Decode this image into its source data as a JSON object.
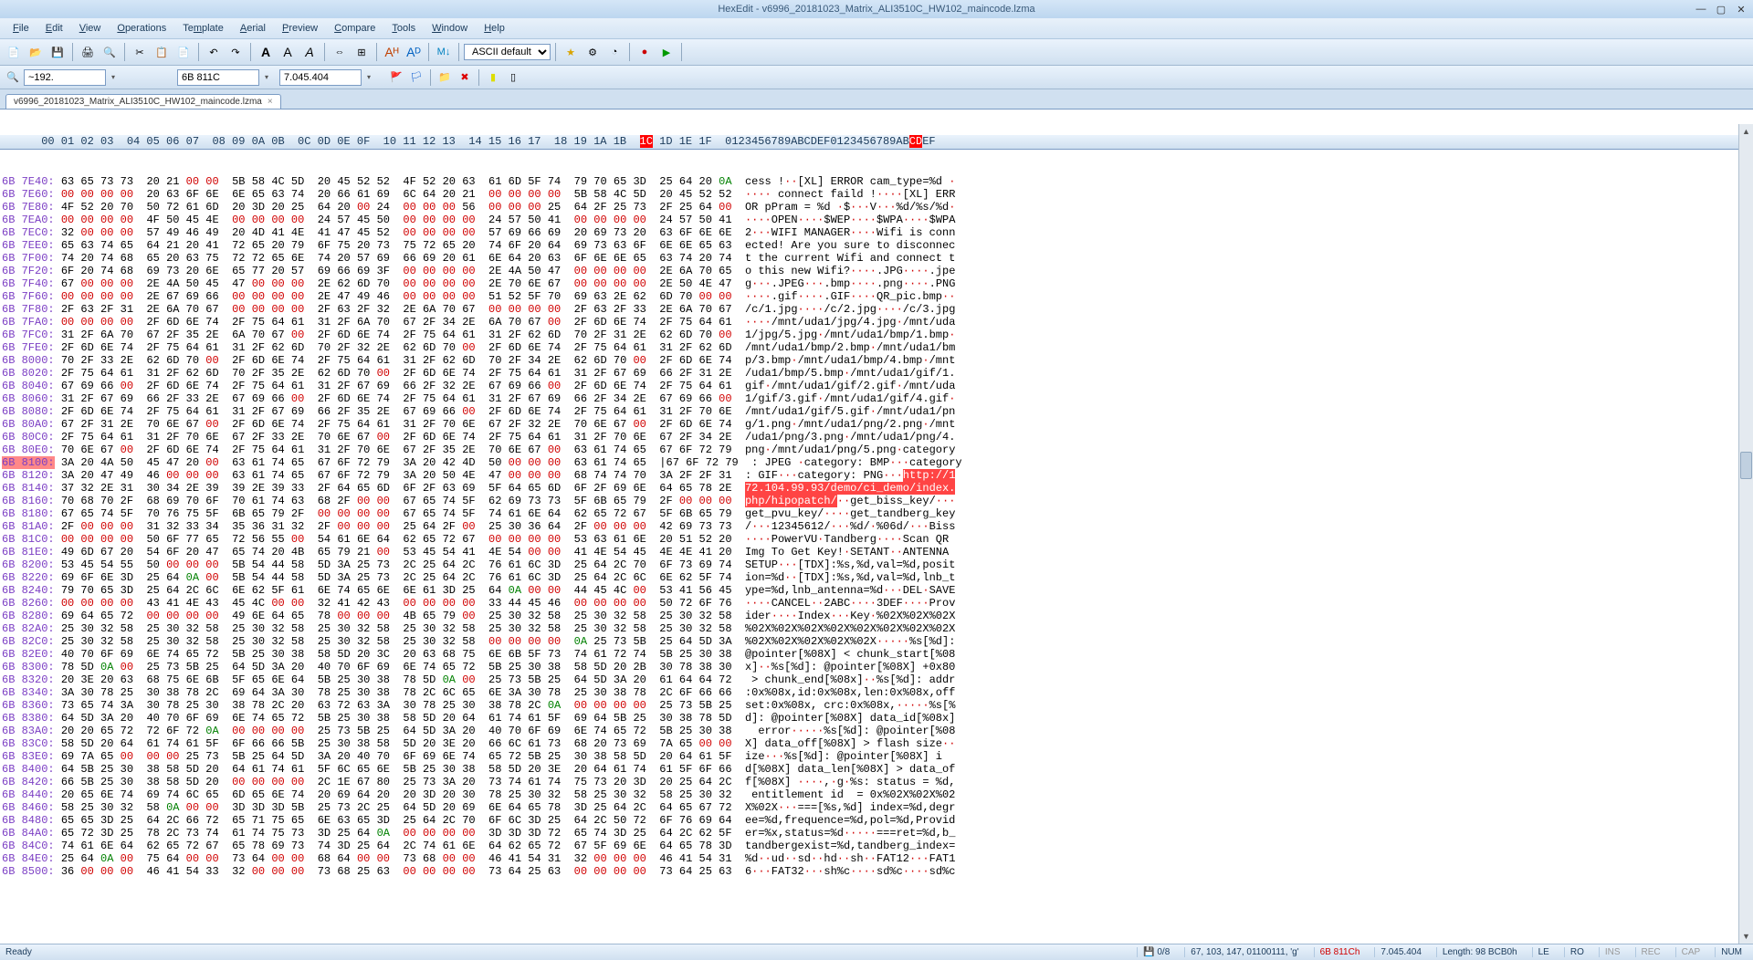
{
  "title": "HexEdit - v6996_20181023_Matrix_ALI3510C_HW102_maincode.lzma",
  "menu": [
    "File",
    "Edit",
    "View",
    "Operations",
    "Template",
    "Aerial",
    "Preview",
    "Compare",
    "Tools",
    "Window",
    "Help"
  ],
  "toolbar": {
    "encoding_select": "ASCII default"
  },
  "toolbar2": {
    "search_hist": "~192.",
    "hex_addr": "6B 811C",
    "dec_addr": "7.045.404"
  },
  "tab": {
    "label": "v6996_20181023_Matrix_ALI3510C_HW102_maincode.lzma"
  },
  "header": {
    "offset_cols": "      00 01 02 03  04 05 06 07  08 09 0A 0B  0C 0D 0E 0F  10 11 12 13  14 15 16 17  18 19 1A 1B  ",
    "hl": "1C",
    "rest": " 1D 1E 1F  0123456789ABCDEF0123456789AB",
    "hl2": "CD",
    "rest2": "EF"
  },
  "rows": [
    {
      "a": "6B 7E40:",
      "h": "63 65 73 73  20 21 00 00  5B 58 4C 5D  20 45 52 52  4F 52 20 63  61 6D 5F 74  79 70 65 3D  25 64 20 0A",
      "t": "cess !··[XL] ERROR cam_type=%d ·"
    },
    {
      "a": "6B 7E60:",
      "h": "00 00 00 00  20 63 6F 6E  6E 65 63 74  20 66 61 69  6C 64 20 21  00 00 00 00  5B 58 4C 5D  20 45 52 52",
      "t": "···· connect faild !····[XL] ERR"
    },
    {
      "a": "6B 7E80:",
      "h": "4F 52 20 70  50 72 61 6D  20 3D 20 25  64 20 00 24  00 00 00 56  00 00 00 25  64 2F 25 73  2F 25 64 00",
      "t": "OR pPram = %d ·$···V···%d/%s/%d·"
    },
    {
      "a": "6B 7EA0:",
      "h": "00 00 00 00  4F 50 45 4E  00 00 00 00  24 57 45 50  00 00 00 00  24 57 50 41  00 00 00 00  24 57 50 41",
      "t": "····OPEN····$WEP····$WPA····$WPA"
    },
    {
      "a": "6B 7EC0:",
      "h": "32 00 00 00  57 49 46 49  20 4D 41 4E  41 47 45 52  00 00 00 00  57 69 66 69  20 69 73 20  63 6F 6E 6E",
      "t": "2···WIFI MANAGER····Wifi is conn"
    },
    {
      "a": "6B 7EE0:",
      "h": "65 63 74 65  64 21 20 41  72 65 20 79  6F 75 20 73  75 72 65 20  74 6F 20 64  69 73 63 6F  6E 6E 65 63",
      "t": "ected! Are you sure to disconnec"
    },
    {
      "a": "6B 7F00:",
      "h": "74 20 74 68  65 20 63 75  72 72 65 6E  74 20 57 69  66 69 20 61  6E 64 20 63  6F 6E 6E 65  63 74 20 74",
      "t": "t the current Wifi and connect t"
    },
    {
      "a": "6B 7F20:",
      "h": "6F 20 74 68  69 73 20 6E  65 77 20 57  69 66 69 3F  00 00 00 00  2E 4A 50 47  00 00 00 00  2E 6A 70 65",
      "t": "o this new Wifi?····.JPG····.jpe"
    },
    {
      "a": "6B 7F40:",
      "h": "67 00 00 00  2E 4A 50 45  47 00 00 00  2E 62 6D 70  00 00 00 00  2E 70 6E 67  00 00 00 00  2E 50 4E 47",
      "t": "g···.JPEG···.bmp····.png····.PNG"
    },
    {
      "a": "6B 7F60:",
      "h": "00 00 00 00  2E 67 69 66  00 00 00 00  2E 47 49 46  00 00 00 00  51 52 5F 70  69 63 2E 62  6D 70 00 00",
      "t": "····.gif····.GIF····QR_pic.bmp··"
    },
    {
      "a": "6B 7F80:",
      "h": "2F 63 2F 31  2E 6A 70 67  00 00 00 00  2F 63 2F 32  2E 6A 70 67  00 00 00 00  2F 63 2F 33  2E 6A 70 67",
      "t": "/c/1.jpg····/c/2.jpg····/c/3.jpg"
    },
    {
      "a": "6B 7FA0:",
      "h": "00 00 00 00  2F 6D 6E 74  2F 75 64 61  31 2F 6A 70  67 2F 34 2E  6A 70 67 00  2F 6D 6E 74  2F 75 64 61",
      "t": "····/mnt/uda1/jpg/4.jpg·/mnt/uda"
    },
    {
      "a": "6B 7FC0:",
      "h": "31 2F 6A 70  67 2F 35 2E  6A 70 67 00  2F 6D 6E 74  2F 75 64 61  31 2F 62 6D  70 2F 31 2E  62 6D 70 00",
      "t": "1/jpg/5.jpg·/mnt/uda1/bmp/1.bmp·"
    },
    {
      "a": "6B 7FE0:",
      "h": "2F 6D 6E 74  2F 75 64 61  31 2F 62 6D  70 2F 32 2E  62 6D 70 00  2F 6D 6E 74  2F 75 64 61  31 2F 62 6D",
      "t": "/mnt/uda1/bmp/2.bmp·/mnt/uda1/bm"
    },
    {
      "a": "6B 8000:",
      "h": "70 2F 33 2E  62 6D 70 00  2F 6D 6E 74  2F 75 64 61  31 2F 62 6D  70 2F 34 2E  62 6D 70 00  2F 6D 6E 74",
      "t": "p/3.bmp·/mnt/uda1/bmp/4.bmp·/mnt"
    },
    {
      "a": "6B 8020:",
      "h": "2F 75 64 61  31 2F 62 6D  70 2F 35 2E  62 6D 70 00  2F 6D 6E 74  2F 75 64 61  31 2F 67 69  66 2F 31 2E",
      "t": "/uda1/bmp/5.bmp·/mnt/uda1/gif/1."
    },
    {
      "a": "6B 8040:",
      "h": "67 69 66 00  2F 6D 6E 74  2F 75 64 61  31 2F 67 69  66 2F 32 2E  67 69 66 00  2F 6D 6E 74  2F 75 64 61",
      "t": "gif·/mnt/uda1/gif/2.gif·/mnt/uda"
    },
    {
      "a": "6B 8060:",
      "h": "31 2F 67 69  66 2F 33 2E  67 69 66 00  2F 6D 6E 74  2F 75 64 61  31 2F 67 69  66 2F 34 2E  67 69 66 00",
      "t": "1/gif/3.gif·/mnt/uda1/gif/4.gif·"
    },
    {
      "a": "6B 8080:",
      "h": "2F 6D 6E 74  2F 75 64 61  31 2F 67 69  66 2F 35 2E  67 69 66 00  2F 6D 6E 74  2F 75 64 61  31 2F 70 6E",
      "t": "/mnt/uda1/gif/5.gif·/mnt/uda1/pn"
    },
    {
      "a": "6B 80A0:",
      "h": "67 2F 31 2E  70 6E 67 00  2F 6D 6E 74  2F 75 64 61  31 2F 70 6E  67 2F 32 2E  70 6E 67 00  2F 6D 6E 74",
      "t": "g/1.png·/mnt/uda1/png/2.png·/mnt"
    },
    {
      "a": "6B 80C0:",
      "h": "2F 75 64 61  31 2F 70 6E  67 2F 33 2E  70 6E 67 00  2F 6D 6E 74  2F 75 64 61  31 2F 70 6E  67 2F 34 2E",
      "t": "/uda1/png/3.png·/mnt/uda1/png/4."
    },
    {
      "a": "6B 80E0:",
      "h": "70 6E 67 00  2F 6D 6E 74  2F 75 64 61  31 2F 70 6E  67 2F 35 2E  70 6E 67 00  63 61 74 65  67 6F 72 79",
      "t": "png·/mnt/uda1/png/5.png·category"
    },
    {
      "a": "6B 8100:",
      "h": "3A 20 4A 50  45 47 20 00  63 61 74 65  67 6F 72 79  3A 20 42 4D  50 00 00 00  63 61 74 65  |67 6F 72 79",
      "t": ": JPEG ·category: BMP···category",
      "cursor": true
    },
    {
      "a": "6B 8120:",
      "h": "3A 20 47 49  46 00 00 00  63 61 74 65  67 6F 72 79  3A 20 50 4E  47 00 00 00  68 74 74 70  3A 2F 2F 31",
      "t": ": GIF···category: PNG···",
      "hl": "http://1"
    },
    {
      "a": "6B 8140:",
      "h": "37 32 2E 31  30 34 2E 39  39 2E 39 33  2F 64 65 6D  6F 2F 63 69  5F 64 65 6D  6F 2F 69 6E  64 65 78 2E",
      "t": "",
      "hl": "72.104.99.93/demo/ci_demo/index."
    },
    {
      "a": "6B 8160:",
      "h": "70 68 70 2F  68 69 70 6F  70 61 74 63  68 2F 00 00  67 65 74 5F  62 69 73 73  5F 6B 65 79  2F 00 00 00",
      "t": "",
      "hl": "php/hipopatch/",
      "t2": "··get_biss_key/···"
    },
    {
      "a": "6B 8180:",
      "h": "67 65 74 5F  70 76 75 5F  6B 65 79 2F  00 00 00 00  67 65 74 5F  74 61 6E 64  62 65 72 67  5F 6B 65 79",
      "t": "get_pvu_key/····get_tandberg_key"
    },
    {
      "a": "6B 81A0:",
      "h": "2F 00 00 00  31 32 33 34  35 36 31 32  2F 00 00 00  25 64 2F 00  25 30 36 64  2F 00 00 00  42 69 73 73",
      "t": "/···12345612/···%d/·%06d/···Biss"
    },
    {
      "a": "6B 81C0:",
      "h": "00 00 00 00  50 6F 77 65  72 56 55 00  54 61 6E 64  62 65 72 67  00 00 00 00  53 63 61 6E  20 51 52 20",
      "t": "····PowerVU·Tandberg····Scan QR "
    },
    {
      "a": "6B 81E0:",
      "h": "49 6D 67 20  54 6F 20 47  65 74 20 4B  65 79 21 00  53 45 54 41  4E 54 00 00  41 4E 54 45  4E 4E 41 20",
      "t": "Img To Get Key!·SETANT··ANTENNA "
    },
    {
      "a": "6B 8200:",
      "h": "53 45 54 55  50 00 00 00  5B 54 44 58  5D 3A 25 73  2C 25 64 2C  76 61 6C 3D  25 64 2C 70  6F 73 69 74",
      "t": "SETUP···[TDX]:%s,%d,val=%d,posit"
    },
    {
      "a": "6B 8220:",
      "h": "69 6F 6E 3D  25 64 0A 00  5B 54 44 58  5D 3A 25 73  2C 25 64 2C  76 61 6C 3D  25 64 2C 6C  6E 62 5F 74",
      "t": "ion=%d··[TDX]:%s,%d,val=%d,lnb_t"
    },
    {
      "a": "6B 8240:",
      "h": "79 70 65 3D  25 64 2C 6C  6E 62 5F 61  6E 74 65 6E  6E 61 3D 25  64 0A 00 00  44 45 4C 00  53 41 56 45",
      "t": "ype=%d,lnb_antenna=%d···DEL·SAVE"
    },
    {
      "a": "6B 8260:",
      "h": "00 00 00 00  43 41 4E 43  45 4C 00 00  32 41 42 43  00 00 00 00  33 44 45 46  00 00 00 00  50 72 6F 76",
      "t": "····CANCEL··2ABC····3DEF····Prov"
    },
    {
      "a": "6B 8280:",
      "h": "69 64 65 72  00 00 00 00  49 6E 64 65  78 00 00 00  4B 65 79 00  25 30 32 58  25 30 32 58  25 30 32 58",
      "t": "ider····Index···Key·%02X%02X%02X"
    },
    {
      "a": "6B 82A0:",
      "h": "25 30 32 58  25 30 32 58  25 30 32 58  25 30 32 58  25 30 32 58  25 30 32 58  25 30 32 58  25 30 32 58",
      "t": "%02X%02X%02X%02X%02X%02X%02X%02X"
    },
    {
      "a": "6B 82C0:",
      "h": "25 30 32 58  25 30 32 58  25 30 32 58  25 30 32 58  25 30 32 58  00 00 00 00  0A 25 73 5B  25 64 5D 3A",
      "t": "%02X%02X%02X%02X%02X·····%s[%d]:"
    },
    {
      "a": "6B 82E0:",
      "h": "40 70 6F 69  6E 74 65 72  5B 25 30 38  58 5D 20 3C  20 63 68 75  6E 6B 5F 73  74 61 72 74  5B 25 30 38",
      "t": "@pointer[%08X] < chunk_start[%08"
    },
    {
      "a": "6B 8300:",
      "h": "78 5D 0A 00  25 73 5B 25  64 5D 3A 20  40 70 6F 69  6E 74 65 72  5B 25 30 38  58 5D 20 2B  30 78 38 30",
      "t": "x]··%s[%d]: @pointer[%08X] +0x80"
    },
    {
      "a": "6B 8320:",
      "h": "20 3E 20 63  68 75 6E 6B  5F 65 6E 64  5B 25 30 38  78 5D 0A 00  25 73 5B 25  64 5D 3A 20  61 64 64 72",
      "t": " > chunk_end[%08x]··%s[%d]: addr"
    },
    {
      "a": "6B 8340:",
      "h": "3A 30 78 25  30 38 78 2C  69 64 3A 30  78 25 30 38  78 2C 6C 65  6E 3A 30 78  25 30 38 78  2C 6F 66 66",
      "t": ":0x%08x,id:0x%08x,len:0x%08x,off"
    },
    {
      "a": "6B 8360:",
      "h": "73 65 74 3A  30 78 25 30  38 78 2C 20  63 72 63 3A  30 78 25 30  38 78 2C 0A  00 00 00 00  25 73 5B 25",
      "t": "set:0x%08x, crc:0x%08x,·····%s[%"
    },
    {
      "a": "6B 8380:",
      "h": "64 5D 3A 20  40 70 6F 69  6E 74 65 72  5B 25 30 38  58 5D 20 64  61 74 61 5F  69 64 5B 25  30 38 78 5D",
      "t": "d]: @pointer[%08X] data_id[%08x]"
    },
    {
      "a": "6B 83A0:",
      "h": "20 20 65 72  72 6F 72 0A  00 00 00 00  25 73 5B 25  64 5D 3A 20  40 70 6F 69  6E 74 65 72  5B 25 30 38",
      "t": "  error·····%s[%d]: @pointer[%08"
    },
    {
      "a": "6B 83C0:",
      "h": "58 5D 20 64  61 74 61 5F  6F 66 66 5B  25 30 38 58  5D 20 3E 20  66 6C 61 73  68 20 73 69  7A 65 00 00",
      "t": "X] data_off[%08X] > flash size··"
    },
    {
      "a": "6B 83E0:",
      "h": "69 7A 65 00  00 00 25 73  5B 25 64 5D  3A 20 40 70  6F 69 6E 74  65 72 5B 25  30 38 58 5D  20 64 61 5F",
      "t": "ize···%s[%d]: @pointer[%08X] i"
    },
    {
      "a": "6B 8400:",
      "h": "64 5B 25 30  38 58 5D 20  64 61 74 61  5F 6C 65 6E  5B 25 30 38  58 5D 20 3E  20 64 61 74  61 5F 6F 66",
      "t": "d[%08X] data_len[%08X] > data_of"
    },
    {
      "a": "6B 8420:",
      "h": "66 5B 25 30  38 58 5D 20  00 00 00 00  2C 1E 67 80  25 73 3A 20  73 74 61 74  75 73 20 3D  20 25 64 2C",
      "t": "f[%08X] ····,·g·%s: status = %d,"
    },
    {
      "a": "6B 8440:",
      "h": "20 65 6E 74  69 74 6C 65  6D 65 6E 74  20 69 64 20  20 3D 20 30  78 25 30 32  58 25 30 32  58 25 30 32",
      "t": " entitlement id  = 0x%02X%02X%02"
    },
    {
      "a": "6B 8460:",
      "h": "58 25 30 32  58 0A 00 00  3D 3D 3D 5B  25 73 2C 25  64 5D 20 69  6E 64 65 78  3D 25 64 2C  64 65 67 72",
      "t": "X%02X···===[%s,%d] index=%d,degr"
    },
    {
      "a": "6B 8480:",
      "h": "65 65 3D 25  64 2C 66 72  65 71 75 65  6E 63 65 3D  25 64 2C 70  6F 6C 3D 25  64 2C 50 72  6F 76 69 64",
      "t": "ee=%d,frequence=%d,pol=%d,Provid"
    },
    {
      "a": "6B 84A0:",
      "h": "65 72 3D 25  78 2C 73 74  61 74 75 73  3D 25 64 0A  00 00 00 00  3D 3D 3D 72  65 74 3D 25  64 2C 62 5F",
      "t": "er=%x,status=%d·····===ret=%d,b_"
    },
    {
      "a": "6B 84C0:",
      "h": "74 61 6E 64  62 65 72 67  65 78 69 73  74 3D 25 64  2C 74 61 6E  64 62 65 72  67 5F 69 6E  64 65 78 3D",
      "t": "tandbergexist=%d,tandberg_index="
    },
    {
      "a": "6B 84E0:",
      "h": "25 64 0A 00  75 64 00 00  73 64 00 00  68 64 00 00  73 68 00 00  46 41 54 31  32 00 00 00  46 41 54 31",
      "t": "%d··ud··sd··hd··sh··FAT12···FAT1"
    },
    {
      "a": "6B 8500:",
      "h": "36 00 00 00  46 41 54 33  32 00 00 00  73 68 25 63  00 00 00 00  73 64 25 63  00 00 00 00  73 64 25 63",
      "t": "6···FAT32···sh%c····sd%c····sd%c"
    }
  ],
  "status": {
    "ready": "Ready",
    "disk": "0/8",
    "pos": "67, 103, 147, 01100111, 'g'",
    "hex_addr": "6B 811Ch",
    "dec_addr": "7.045.404",
    "length": "Length: 98 BCB0h",
    "endian": "LE",
    "mode": "RO",
    "ins": "INS",
    "rec": "REC",
    "caps": "CAP",
    "num": "NUM"
  }
}
